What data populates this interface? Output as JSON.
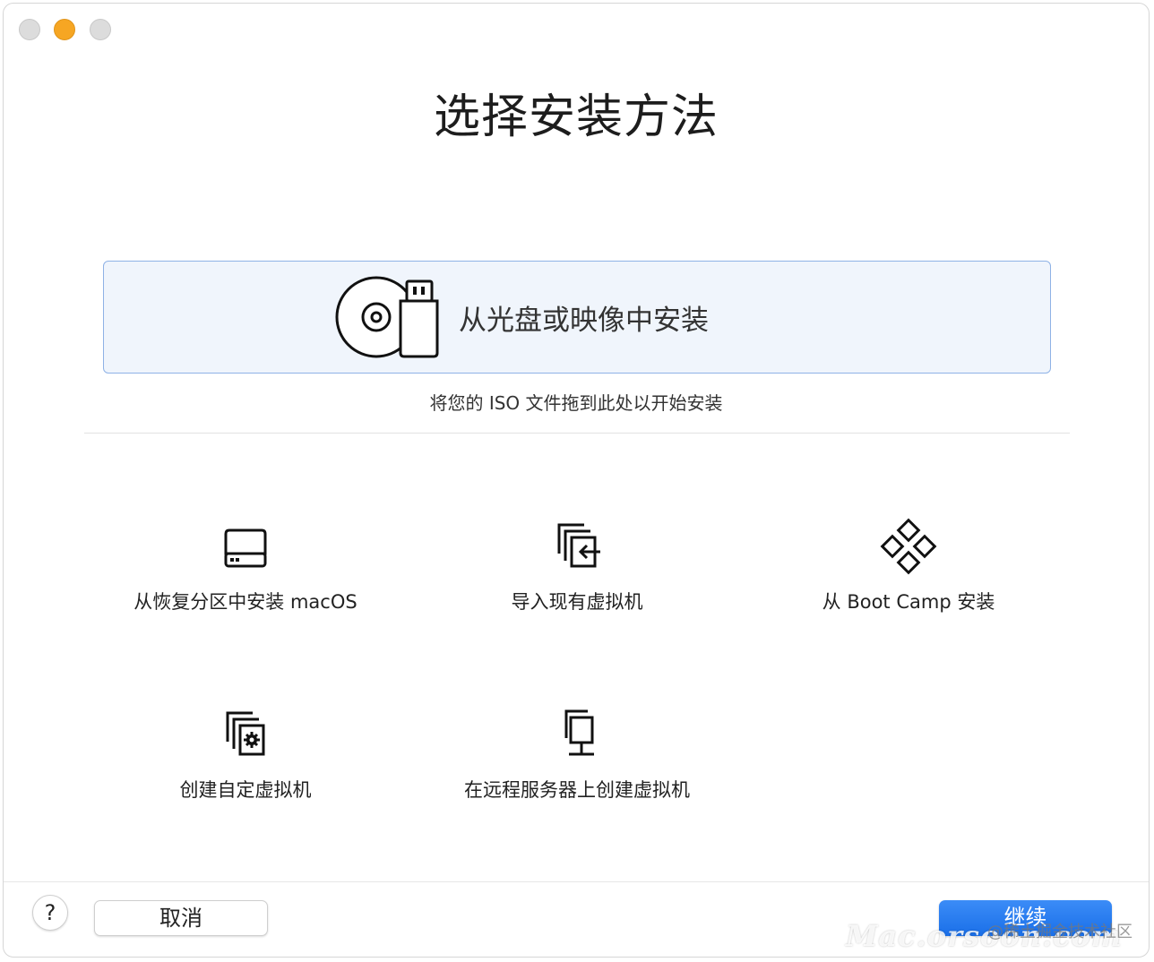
{
  "window": {
    "title": "选择安装方法"
  },
  "primary": {
    "label": "从光盘或映像中安装",
    "hint": "将您的 ISO 文件拖到此处以开始安装",
    "icon": "disc-usb-icon"
  },
  "options": [
    {
      "label": "从恢复分区中安装 macOS",
      "icon": "hard-drive-icon"
    },
    {
      "label": "导入现有虚拟机",
      "icon": "import-vm-icon"
    },
    {
      "label": "从 Boot Camp 安装",
      "icon": "bootcamp-icon"
    },
    {
      "label": "创建自定虚拟机",
      "icon": "custom-vm-icon"
    },
    {
      "label": "在远程服务器上创建虚拟机",
      "icon": "remote-server-icon"
    }
  ],
  "footer": {
    "help_label": "?",
    "cancel_label": "取消",
    "continue_label": "继续"
  },
  "watermark": {
    "text": "Mac.orsoon.com",
    "sub": "@稀土掘金技术社区"
  },
  "colors": {
    "accent": "#1a6fe8",
    "card_border": "#8fb2e6",
    "card_bg": "#f0f5fc",
    "minimize": "#f6a623"
  }
}
